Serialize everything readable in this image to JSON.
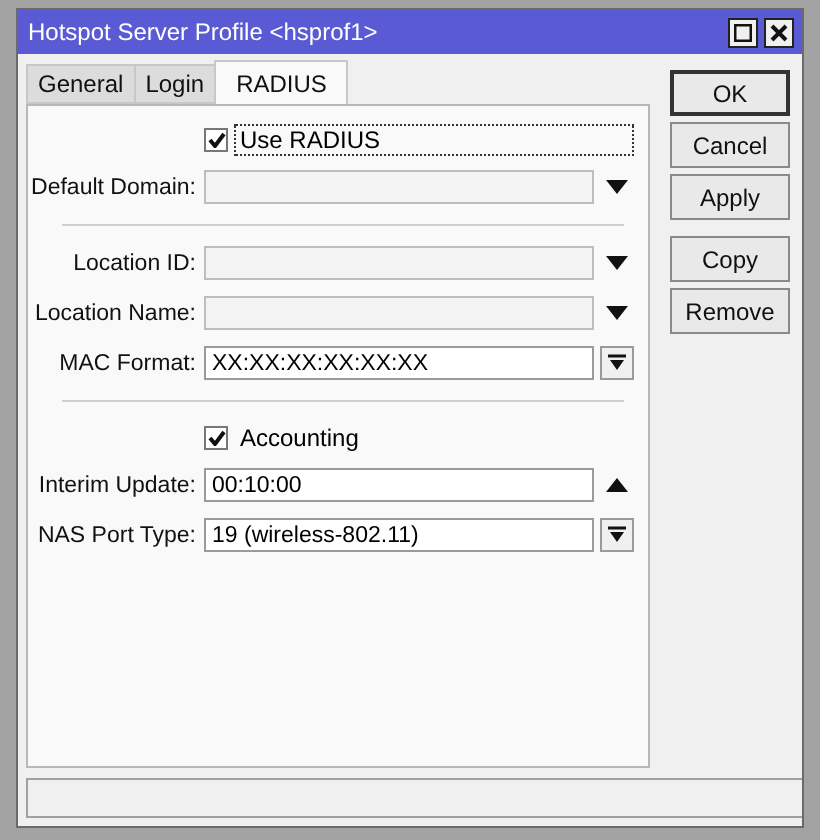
{
  "window": {
    "title": "Hotspot Server Profile <hsprof1>"
  },
  "tabs": [
    {
      "label": "General",
      "selected": false
    },
    {
      "label": "Login",
      "selected": false
    },
    {
      "label": "RADIUS",
      "selected": true
    }
  ],
  "rows": [
    {
      "kind": "checkbox",
      "label": "Use RADIUS",
      "checked": true,
      "focused": true
    },
    {
      "kind": "field",
      "label": "Default Domain:",
      "value": "",
      "disabled": true,
      "button": {
        "kind": "dropdown"
      }
    },
    {
      "kind": "divider"
    },
    {
      "kind": "field",
      "label": "Location ID:",
      "value": "",
      "disabled": true,
      "button": {
        "kind": "dropdown"
      }
    },
    {
      "kind": "field",
      "label": "Location Name:",
      "value": "",
      "disabled": true,
      "button": {
        "kind": "dropdown"
      }
    },
    {
      "kind": "field",
      "label": "MAC Format:",
      "value": "XX:XX:XX:XX:XX:XX",
      "disabled": false,
      "button": {
        "kind": "select"
      }
    },
    {
      "kind": "divider"
    },
    {
      "kind": "checkbox",
      "label": "Accounting",
      "checked": true,
      "focused": false
    },
    {
      "kind": "field",
      "label": "Interim Update:",
      "value": "00:10:00",
      "disabled": false,
      "button": {
        "kind": "collapse"
      }
    },
    {
      "kind": "field",
      "label": "NAS Port Type:",
      "value": "19 (wireless-802.11)",
      "disabled": false,
      "button": {
        "kind": "select"
      }
    }
  ],
  "button_groups": [
    [
      {
        "label": "OK",
        "default": true
      },
      {
        "label": "Cancel",
        "default": false
      },
      {
        "label": "Apply",
        "default": false
      }
    ],
    [
      {
        "label": "Copy",
        "default": false
      },
      {
        "label": "Remove",
        "default": false
      }
    ]
  ]
}
